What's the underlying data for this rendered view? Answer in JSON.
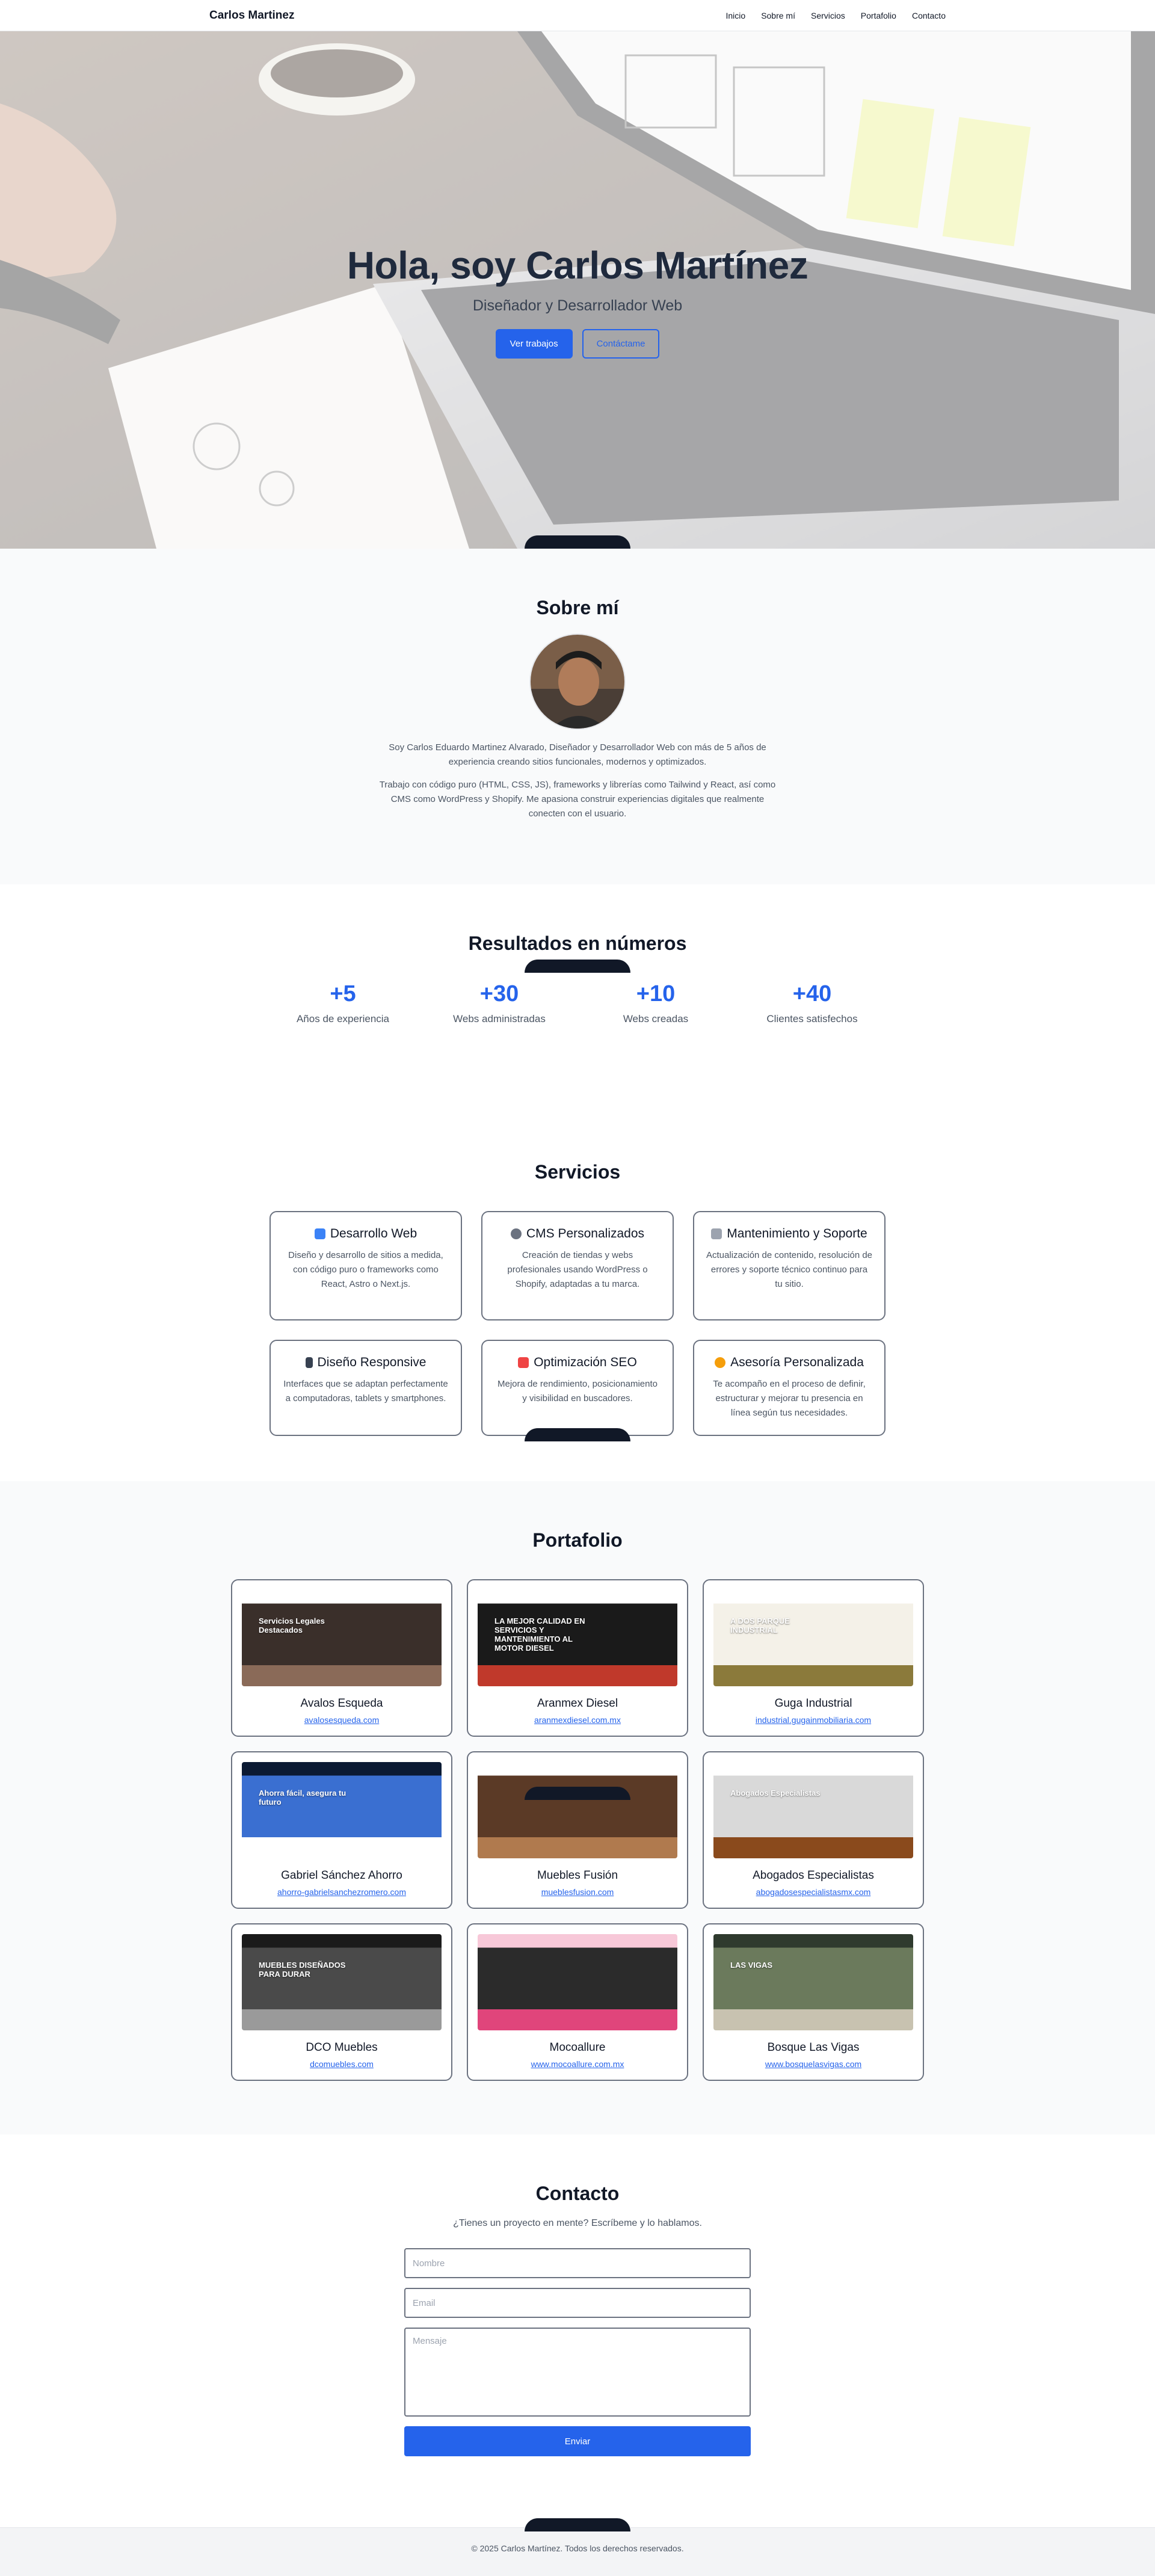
{
  "nav": {
    "brand": "Carlos Martinez",
    "links": [
      "Inicio",
      "Sobre mí",
      "Servicios",
      "Portafolio",
      "Contacto"
    ]
  },
  "hero": {
    "title": "Hola, soy Carlos Martínez",
    "subtitle": "Diseñador y Desarrollador Web",
    "primary_button": "Ver trabajos",
    "secondary_button": "Contáctame"
  },
  "about": {
    "title": "Sobre mí",
    "paragraph1": "Soy Carlos Eduardo Martinez Alvarado, Diseñador y Desarrollador Web con más de 5 años de experiencia creando sitios funcionales, modernos y optimizados.",
    "paragraph2": "Trabajo con código puro (HTML, CSS, JS), frameworks y librerías como Tailwind y React, así como CMS como WordPress y Shopify. Me apasiona construir experiencias digitales que realmente conecten con el usuario."
  },
  "stats": {
    "title": "Resultados en números",
    "items": [
      {
        "value": "+5",
        "label": "Años de experiencia"
      },
      {
        "value": "+30",
        "label": "Webs administradas"
      },
      {
        "value": "+10",
        "label": "Webs creadas"
      },
      {
        "value": "+40",
        "label": "Clientes satisfechos"
      }
    ]
  },
  "services": {
    "title": "Servicios",
    "items": [
      {
        "icon": "book-icon",
        "color": "#3b82f6",
        "title": "Desarrollo Web",
        "text": "Diseño y desarrollo de sitios a medida, con código puro o frameworks como React, Astro o Next.js."
      },
      {
        "icon": "gear-icon",
        "color": "#6b7280",
        "title": "CMS Personalizados",
        "text": "Creación de tiendas y webs profesionales usando WordPress o Shopify, adaptadas a tu marca."
      },
      {
        "icon": "tools-icon",
        "color": "#9ca3af",
        "title": "Mantenimiento y Soporte",
        "text": "Actualización de contenido, resolución de errores y soporte técnico continuo para tu sitio."
      },
      {
        "icon": "mobile-icon",
        "color": "#374151",
        "title": "Diseño Responsive",
        "text": "Interfaces que se adaptan perfectamente a computadoras, tablets y smartphones."
      },
      {
        "icon": "rocket-icon",
        "color": "#ef4444",
        "title": "Optimización SEO",
        "text": "Mejora de rendimiento, posicionamiento y visibilidad en buscadores."
      },
      {
        "icon": "handshake-icon",
        "color": "#f59e0b",
        "title": "Asesoría Personalizada",
        "text": "Te acompaño en el proceso de definir, estructurar y mejorar tu presencia en línea según tus necesidades."
      }
    ]
  },
  "portfolio": {
    "title": "Portafolio",
    "items": [
      {
        "name": "Avalos Esqueda",
        "url": "avalosesqueda.com",
        "thumb_headline": "Servicios Legales Destacados",
        "colors": [
          "#ffffff",
          "#3a2f2a",
          "#8a6a58"
        ]
      },
      {
        "name": "Aranmex Diesel",
        "url": "aranmexdiesel.com.mx",
        "thumb_headline": "LA MEJOR CALIDAD EN SERVICIOS Y MANTENIMIENTO AL MOTOR DIESEL",
        "colors": [
          "#ffffff",
          "#1a1a1a",
          "#c0392b"
        ]
      },
      {
        "name": "Guga Industrial",
        "url": "industrial.gugainmobiliaria.com",
        "thumb_headline": "A DOS PARQUE INDUSTRIAL",
        "colors": [
          "#ffffff",
          "#f4f1e8",
          "#8b7a3b"
        ]
      },
      {
        "name": "Gabriel Sánchez Ahorro",
        "url": "ahorro-gabrielsanchezromero.com",
        "thumb_headline": "Ahorra fácil, asegura tu futuro",
        "colors": [
          "#0b1a33",
          "#3a6fd1",
          "#ffffff"
        ]
      },
      {
        "name": "Muebles Fusión",
        "url": "mueblesfusion.com",
        "thumb_headline": "",
        "colors": [
          "#ffffff",
          "#5b3a26",
          "#b07a4e"
        ]
      },
      {
        "name": "Abogados Especialistas",
        "url": "abogadosespecialistasmx.com",
        "thumb_headline": "Abogados Especialistas",
        "colors": [
          "#ffffff",
          "#d9d9d9",
          "#8a4a1c"
        ]
      },
      {
        "name": "DCO Muebles",
        "url": "dcomuebles.com",
        "thumb_headline": "MUEBLES DISEÑADOS PARA DURAR",
        "colors": [
          "#1a1a1a",
          "#4a4a4a",
          "#9a9a9a"
        ]
      },
      {
        "name": "Mocoallure",
        "url": "www.mocoallure.com.mx",
        "thumb_headline": "",
        "colors": [
          "#f7c8d8",
          "#2b2b2b",
          "#e0457b"
        ]
      },
      {
        "name": "Bosque Las Vigas",
        "url": "www.bosquelasvigas.com",
        "thumb_headline": "LAS VIGAS",
        "colors": [
          "#2f3a2e",
          "#6b7a5c",
          "#c8c2b0"
        ]
      }
    ]
  },
  "contact": {
    "title": "Contacto",
    "lead": "¿Tienes un proyecto en mente? Escríbeme y lo hablamos.",
    "name_placeholder": "Nombre",
    "email_placeholder": "Email",
    "message_placeholder": "Mensaje",
    "submit": "Enviar"
  },
  "footer": {
    "text": "© 2025 Carlos Martínez. Todos los derechos reservados."
  }
}
